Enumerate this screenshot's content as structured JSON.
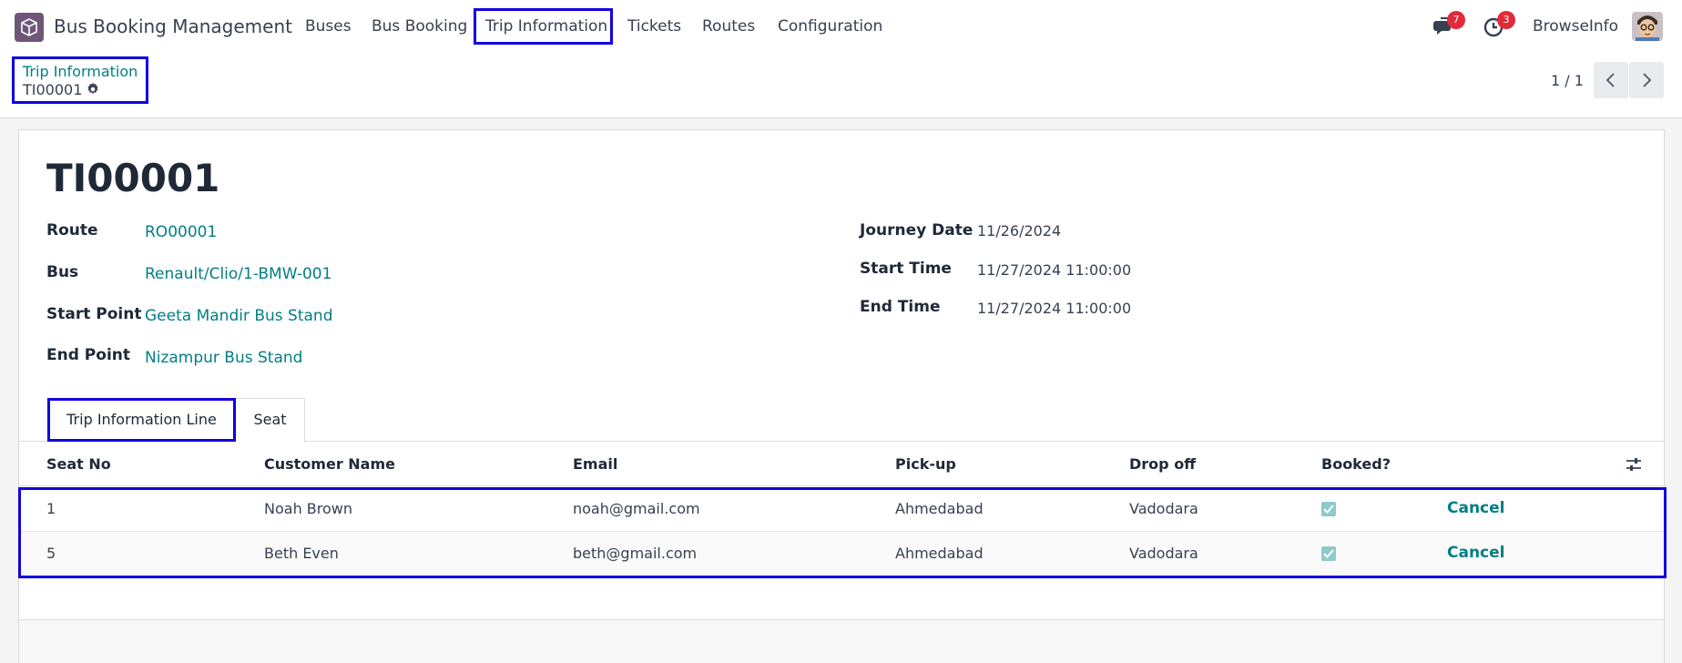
{
  "app": {
    "name": "Bus Booking Management"
  },
  "nav": {
    "items": [
      {
        "label": "Buses"
      },
      {
        "label": "Bus Booking"
      },
      {
        "label": "Trip Information"
      },
      {
        "label": "Tickets"
      },
      {
        "label": "Routes"
      },
      {
        "label": "Configuration"
      }
    ],
    "active": "Trip Information"
  },
  "systray": {
    "messages_icon": "chat-icon",
    "messages_count": "7",
    "activity_icon": "clock-icon",
    "activity_count": "3",
    "user_name": "BrowseInfo"
  },
  "breadcrumb": {
    "parent": "Trip Information",
    "current": "TI00001"
  },
  "pager": {
    "value": "1 / 1"
  },
  "record": {
    "title": "TI00001",
    "fields_left": [
      {
        "label": "Route",
        "value": "RO00001"
      },
      {
        "label": "Bus",
        "value": "Renault/Clio/1-BMW-001"
      },
      {
        "label": "Start Point",
        "value": "Geeta Mandir Bus Stand"
      },
      {
        "label": "End Point",
        "value": "Nizampur Bus Stand"
      }
    ],
    "fields_right": [
      {
        "label": "Journey Date",
        "value": "11/26/2024"
      },
      {
        "label": "Start Time",
        "value": "11/27/2024 11:00:00"
      },
      {
        "label": "End Time",
        "value": "11/27/2024 11:00:00"
      }
    ]
  },
  "tabs": [
    {
      "label": "Trip Information Line",
      "active": true
    },
    {
      "label": "Seat",
      "active": false
    }
  ],
  "table": {
    "columns": [
      "Seat No",
      "Customer Name",
      "Email",
      "Pick-up",
      "Drop off",
      "Booked?"
    ],
    "rows": [
      {
        "seat": "1",
        "customer": "Noah Brown",
        "email": "noah@gmail.com",
        "pickup": "Ahmedabad",
        "dropoff": "Vadodara",
        "booked": true,
        "action": "Cancel"
      },
      {
        "seat": "5",
        "customer": "Beth Even",
        "email": "beth@gmail.com",
        "pickup": "Ahmedabad",
        "dropoff": "Vadodara",
        "booked": true,
        "action": "Cancel"
      }
    ]
  },
  "colors": {
    "link": "#017e84",
    "highlight": "#1000e0",
    "badge": "#e22b3a"
  }
}
